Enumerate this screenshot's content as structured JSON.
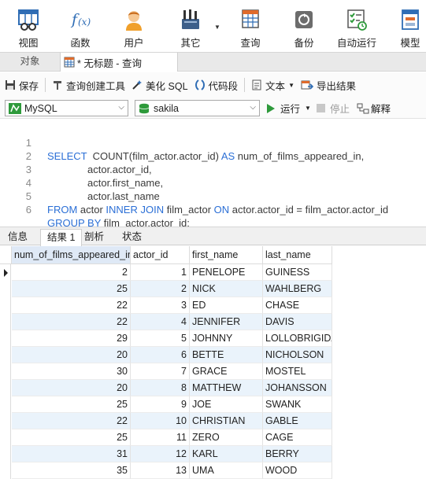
{
  "toolbar": {
    "items": [
      {
        "label": "视图"
      },
      {
        "label": "函数"
      },
      {
        "label": "用户"
      },
      {
        "label": "其它"
      },
      {
        "label": "查询"
      },
      {
        "label": "备份"
      },
      {
        "label": "自动运行"
      },
      {
        "label": "模型"
      }
    ]
  },
  "tabs": {
    "objects": "对象",
    "query": "* 无标题 - 查询"
  },
  "query_toolbar": {
    "save": "保存",
    "builder": "查询创建工具",
    "beautify": "美化 SQL",
    "snippet": "代码段",
    "text": "文本",
    "export": "导出结果"
  },
  "connection": {
    "server": "MySQL",
    "database": "sakila",
    "run": "运行",
    "stop": "停止",
    "explain": "解释"
  },
  "editor": {
    "line_numbers": [
      "1",
      "2",
      "3",
      "4",
      "5",
      "6"
    ]
  },
  "result_tabs": [
    "信息",
    "结果 1",
    "剖析",
    "状态"
  ],
  "grid": {
    "columns": [
      "num_of_films_appeared_in",
      "actor_id",
      "first_name",
      "last_name"
    ],
    "rows": [
      [
        "2",
        "1",
        "PENELOPE",
        "GUINESS"
      ],
      [
        "25",
        "2",
        "NICK",
        "WAHLBERG"
      ],
      [
        "22",
        "3",
        "ED",
        "CHASE"
      ],
      [
        "22",
        "4",
        "JENNIFER",
        "DAVIS"
      ],
      [
        "29",
        "5",
        "JOHNNY",
        "LOLLOBRIGIDA"
      ],
      [
        "20",
        "6",
        "BETTE",
        "NICHOLSON"
      ],
      [
        "30",
        "7",
        "GRACE",
        "MOSTEL"
      ],
      [
        "20",
        "8",
        "MATTHEW",
        "JOHANSSON"
      ],
      [
        "25",
        "9",
        "JOE",
        "SWANK"
      ],
      [
        "22",
        "10",
        "CHRISTIAN",
        "GABLE"
      ],
      [
        "25",
        "11",
        "ZERO",
        "CAGE"
      ],
      [
        "31",
        "12",
        "KARL",
        "BERRY"
      ],
      [
        "35",
        "13",
        "UMA",
        "WOOD"
      ]
    ]
  },
  "colors": {
    "keyword": "#2b6fd6",
    "selected_header": "#dfe9f6",
    "alt_row": "#eaf3fb"
  },
  "icons": [
    "view-icon",
    "function-icon",
    "user-icon",
    "other-tools-icon",
    "query-icon",
    "backup-icon",
    "schedule-icon",
    "model-icon"
  ]
}
